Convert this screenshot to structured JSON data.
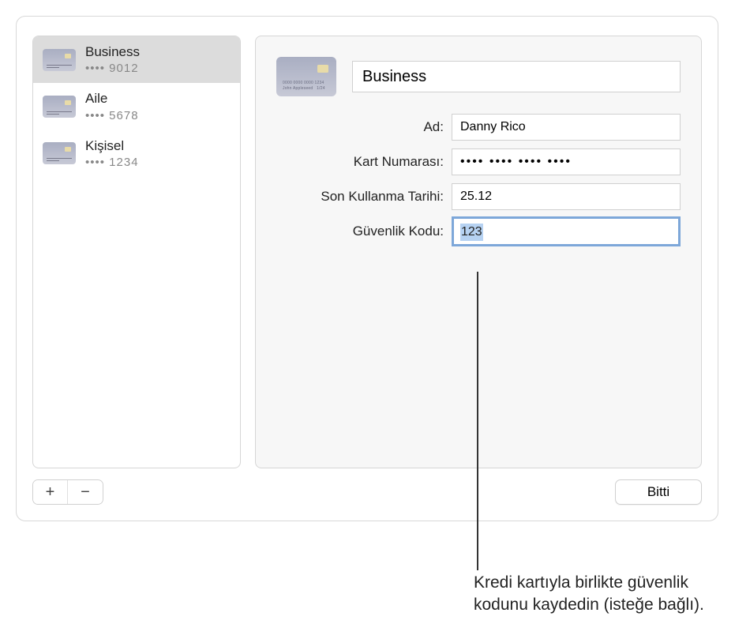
{
  "sidebar": {
    "items": [
      {
        "title": "Business",
        "sub": "•••• 9012",
        "selected": true
      },
      {
        "title": "Aile",
        "sub": "•••• 5678",
        "selected": false
      },
      {
        "title": "Kişisel",
        "sub": "•••• 1234",
        "selected": false
      }
    ]
  },
  "detail": {
    "title": "Business",
    "fields": {
      "name_label": "Ad:",
      "name_value": "Danny Rico",
      "number_label": "Kart Numarası:",
      "number_value": "•••• •••• •••• ••••",
      "expiry_label": "Son Kullanma Tarihi:",
      "expiry_value": "25.12",
      "cvc_label": "Güvenlik Kodu:",
      "cvc_value": "123"
    }
  },
  "footer": {
    "add": "+",
    "remove": "−",
    "done": "Bitti"
  },
  "callout": "Kredi kartıyla birlikte güvenlik kodunu kaydedin (isteğe bağlı)."
}
